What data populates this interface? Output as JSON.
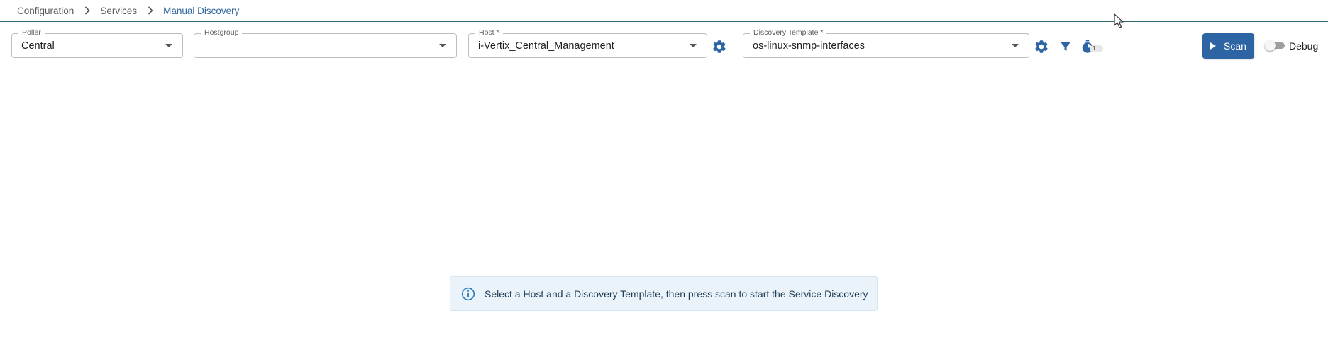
{
  "breadcrumb": {
    "items": [
      "Configuration",
      "Services",
      "Manual Discovery"
    ]
  },
  "filters": {
    "poller": {
      "label": "Poller",
      "value": "Central"
    },
    "hostgroup": {
      "label": "Hostgroup",
      "value": ""
    },
    "host": {
      "label": "Host *",
      "value": "i-Vertix_Central_Management"
    },
    "template": {
      "label": "Discovery Template *",
      "value": "os-linux-snmp-interfaces"
    }
  },
  "timer_badge": "1...",
  "scan_label": "Scan",
  "debug": {
    "label": "Debug",
    "enabled": false
  },
  "info_message": "Select a Host and a Discovery Template, then press scan to start the Service Discovery",
  "colors": {
    "accent": "#2c64a4",
    "info_bg": "#eaf3fa",
    "info_icon": "#2a7bbd"
  },
  "icons": {
    "breadcrumb_separator": "chevron-right-icon",
    "select_caret": "caret-down-icon",
    "host_settings": "gear-icon",
    "template_settings": "gear-icon",
    "filter": "filter-icon",
    "timer": "timer-icon",
    "scan": "play-icon",
    "info": "info-icon",
    "cursor": "mouse-cursor-icon"
  }
}
